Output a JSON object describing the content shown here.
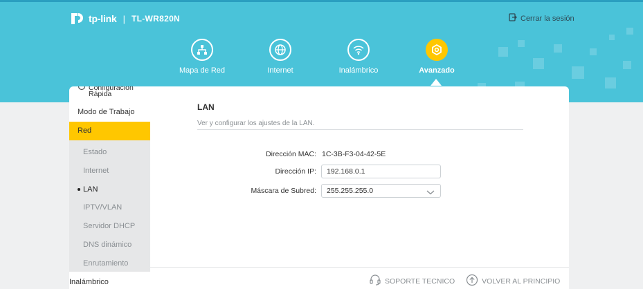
{
  "header": {
    "brand": "tp-link",
    "separator": "|",
    "model": "TL-WR820N",
    "logout_label": "Cerrar la sesión",
    "logout_icon": "logout-icon",
    "bg_color": "#4ac3d9",
    "active_color": "#ffc700"
  },
  "nav": {
    "items": [
      {
        "label": "Mapa de Red",
        "icon": "network-map-icon"
      },
      {
        "label": "Internet",
        "icon": "globe-icon"
      },
      {
        "label": "Inalámbrico",
        "icon": "wifi-icon"
      },
      {
        "label": "Avanzado",
        "icon": "gear-icon",
        "active": true
      }
    ]
  },
  "sidebar": {
    "top_item": [
      "Configuración",
      "Rápida"
    ],
    "items": [
      {
        "label": "Modo de Trabajo"
      },
      {
        "label": "Red",
        "active": true
      }
    ],
    "subitems": [
      {
        "label": "Estado"
      },
      {
        "label": "Internet"
      },
      {
        "label": "LAN",
        "current": true
      },
      {
        "label": "IPTV/VLAN"
      },
      {
        "label": "Servidor DHCP"
      },
      {
        "label": "DNS dinámico"
      },
      {
        "label": "Enrutamiento"
      }
    ],
    "bottom_item": "Inalámbrico"
  },
  "content": {
    "title": "LAN",
    "description": "Ver y configurar los ajustes de la LAN.",
    "fields": {
      "mac_label": "Dirección MAC:",
      "mac_value": "1C-3B-F3-04-42-5E",
      "ip_label": "Dirección IP:",
      "ip_value": "192.168.0.1",
      "mask_label": "Máscara de Subred:",
      "mask_value": "255.255.255.0"
    }
  },
  "footer": {
    "support_label": "SOPORTE TECNICO",
    "top_label": "VOLVER AL PRINCIPIO"
  }
}
